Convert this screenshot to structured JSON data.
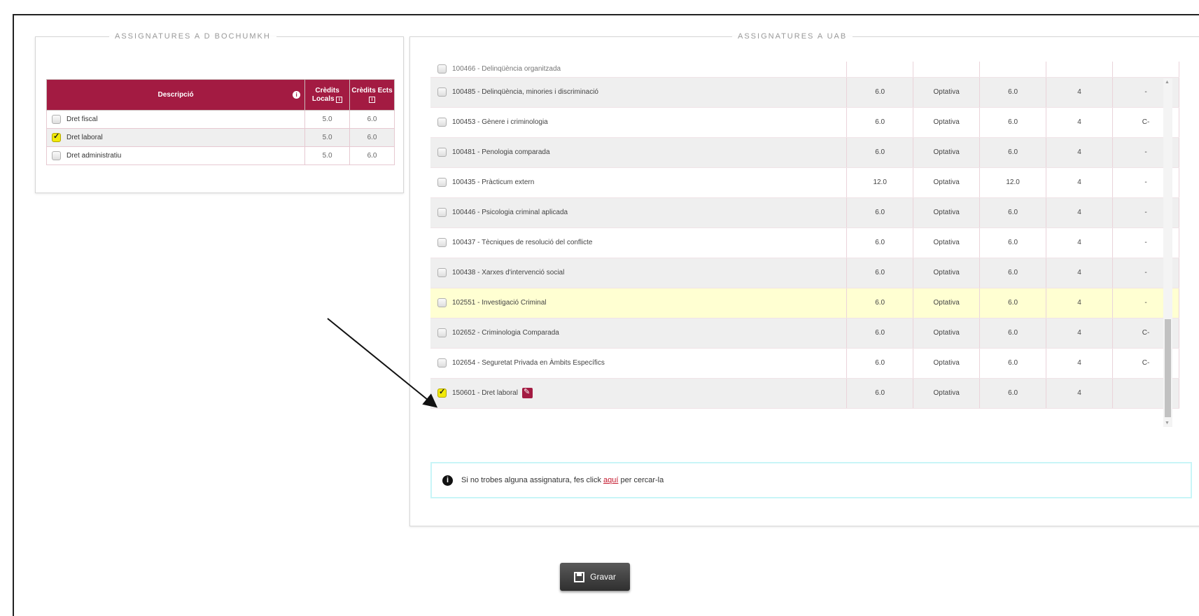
{
  "left_panel": {
    "legend": "ASSIGNATURES A D BOCHUMKH",
    "headers": {
      "desc": "Descripció",
      "credits_local": "Crèdits Locals",
      "credits_ects": "Crèdits Ects"
    },
    "rows": [
      {
        "name": "Dret fiscal",
        "local": "5.0",
        "ects": "6.0",
        "checked": false
      },
      {
        "name": "Dret laboral",
        "local": "5.0",
        "ects": "6.0",
        "checked": true
      },
      {
        "name": "Dret administratiu",
        "local": "5.0",
        "ects": "6.0",
        "checked": false
      }
    ]
  },
  "right_panel": {
    "legend": "ASSIGNATURES A UAB",
    "partial_row": "100466 - Delinqüència organitzada",
    "rows": [
      {
        "name": "100485 - Delinqüència, minories i discriminació",
        "credits": "6.0",
        "type": "Optativa",
        "ects": "6.0",
        "course": "4",
        "extra": "-"
      },
      {
        "name": "100453 - Gènere i criminologia",
        "credits": "6.0",
        "type": "Optativa",
        "ects": "6.0",
        "course": "4",
        "extra": "C-"
      },
      {
        "name": "100481 - Penologia comparada",
        "credits": "6.0",
        "type": "Optativa",
        "ects": "6.0",
        "course": "4",
        "extra": "-"
      },
      {
        "name": "100435 - Pràcticum extern",
        "credits": "12.0",
        "type": "Optativa",
        "ects": "12.0",
        "course": "4",
        "extra": "-"
      },
      {
        "name": "100446 - Psicologia criminal aplicada",
        "credits": "6.0",
        "type": "Optativa",
        "ects": "6.0",
        "course": "4",
        "extra": "-"
      },
      {
        "name": "100437 - Tècniques de resolució del conflicte",
        "credits": "6.0",
        "type": "Optativa",
        "ects": "6.0",
        "course": "4",
        "extra": "-"
      },
      {
        "name": "100438 - Xarxes d'intervenció social",
        "credits": "6.0",
        "type": "Optativa",
        "ects": "6.0",
        "course": "4",
        "extra": "-"
      },
      {
        "name": "102551 - Investigació Criminal",
        "credits": "6.0",
        "type": "Optativa",
        "ects": "6.0",
        "course": "4",
        "extra": "-"
      },
      {
        "name": "102652 - Criminologia Comparada",
        "credits": "6.0",
        "type": "Optativa",
        "ects": "6.0",
        "course": "4",
        "extra": "C-"
      },
      {
        "name": "102654 - Seguretat Privada en Àmbits Específics",
        "credits": "6.0",
        "type": "Optativa",
        "ects": "6.0",
        "course": "4",
        "extra": "C-"
      },
      {
        "name": "150601 - Dret laboral",
        "credits": "6.0",
        "type": "Optativa",
        "ects": "6.0",
        "course": "4",
        "extra": ""
      }
    ]
  },
  "notice": {
    "before": "Si no trobes alguna assignatura, fes click",
    "link": "aquí",
    "after": "per cercar-la"
  },
  "save_button": "Gravar",
  "icons": {
    "info": "info-icon",
    "edit": "edit-icon",
    "save": "floppy-disk-icon"
  },
  "colors": {
    "header": "#a31b42",
    "checked": "#f1ea0a",
    "highlight": "#ffffd2"
  }
}
